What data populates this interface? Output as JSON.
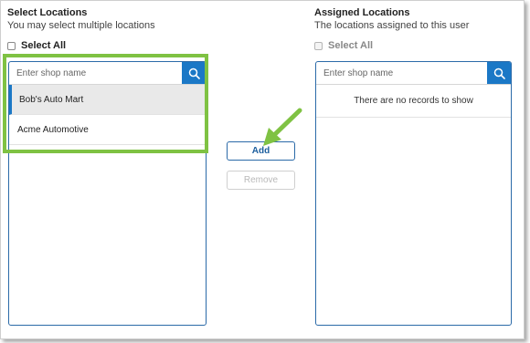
{
  "left_panel": {
    "title": "Select Locations",
    "subtitle": "You may select multiple locations",
    "select_all_label": "Select All",
    "search_placeholder": "Enter shop name",
    "items": [
      {
        "label": "Bob's Auto Mart",
        "selected": true
      },
      {
        "label": "Acme Automotive",
        "selected": false
      }
    ]
  },
  "actions": {
    "add_label": "Add",
    "remove_label": "Remove",
    "remove_disabled": true
  },
  "right_panel": {
    "title": "Assigned Locations",
    "subtitle": "The locations assigned to this user",
    "select_all_label": "Select All",
    "select_all_disabled": true,
    "search_placeholder": "Enter shop name",
    "empty_message": "There are no records to show"
  },
  "colors": {
    "accent": "#1b78c6",
    "border": "#2b6aa8",
    "highlight": "#7fc243",
    "selected_row": "#e9e9e9"
  },
  "icons": {
    "search": "search-icon",
    "callout_arrow": "arrow-icon"
  }
}
